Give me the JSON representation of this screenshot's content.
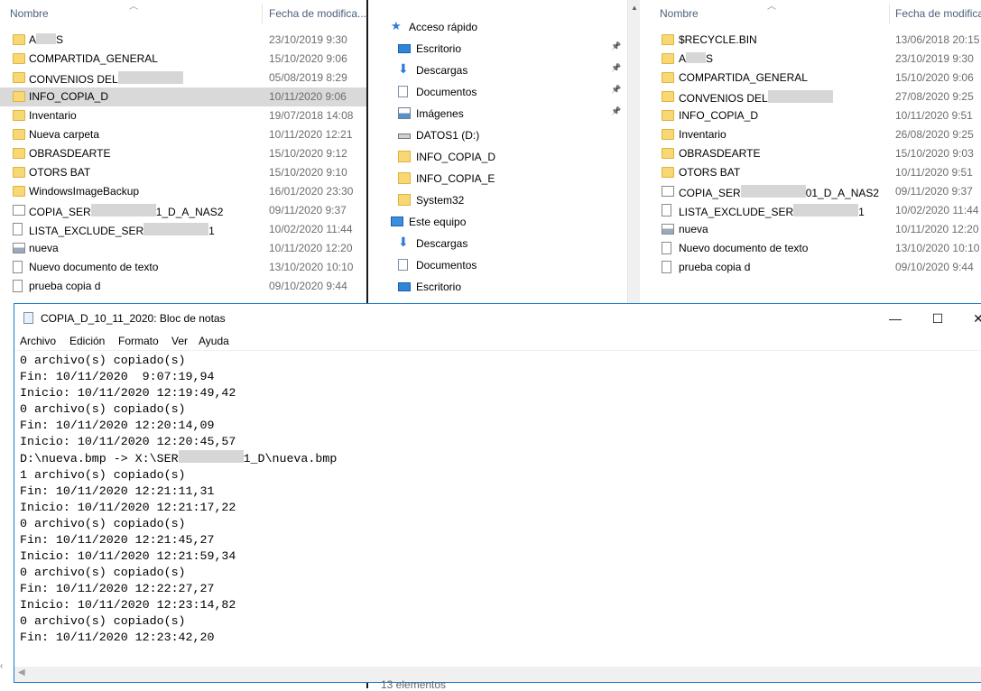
{
  "left_pane": {
    "col_name": "Nombre",
    "col_date": "Fecha de modifica...",
    "rows": [
      {
        "name": "A",
        "name_tail": "S",
        "date": "23/10/2019 9:30",
        "icon": "folder-icon"
      },
      {
        "name": "COMPARTIDA_GENERAL",
        "date": "15/10/2020 9:06",
        "icon": "folder-icon"
      },
      {
        "name": "CONVENIOS DEL",
        "date": "05/08/2019 8:29",
        "icon": "folder-icon"
      },
      {
        "name": "INFO_COPIA_D",
        "date": "10/11/2020 9:06",
        "icon": "folder-icon",
        "selected": true
      },
      {
        "name": "Inventario",
        "date": "19/07/2018 14:08",
        "icon": "folder-icon"
      },
      {
        "name": "Nueva carpeta",
        "date": "10/11/2020 12:21",
        "icon": "folder-icon"
      },
      {
        "name": "OBRASDEARTE",
        "date": "15/10/2020 9:12",
        "icon": "folder-icon"
      },
      {
        "name": "OTORS BAT",
        "date": "15/10/2020 9:10",
        "icon": "folder-icon"
      },
      {
        "name": "WindowsImageBackup",
        "date": "16/01/2020 23:30",
        "icon": "folder-icon"
      },
      {
        "name": "COPIA_SER",
        "name_tail": "1_D_A_NAS2",
        "date": "09/11/2020 9:37",
        "icon": "batch-file-icon"
      },
      {
        "name": "LISTA_EXCLUDE_SER",
        "name_tail": "1",
        "date": "10/02/2020 11:44",
        "icon": "text-file-icon"
      },
      {
        "name": "nueva",
        "date": "10/11/2020 12:20",
        "icon": "bitmap-file-icon"
      },
      {
        "name": "Nuevo documento de texto",
        "date": "13/10/2020 10:10",
        "icon": "text-file-icon"
      },
      {
        "name": "prueba copia d",
        "date": "09/10/2020 9:44",
        "icon": "text-file-icon"
      }
    ]
  },
  "nav_pane": {
    "items": [
      {
        "label": "Acceso rápido",
        "icon": "star-icon",
        "level": 0
      },
      {
        "label": "Escritorio",
        "icon": "desktop-icon",
        "level": 1,
        "pinned": true
      },
      {
        "label": "Descargas",
        "icon": "download-icon",
        "level": 1,
        "pinned": true
      },
      {
        "label": "Documentos",
        "icon": "documents-icon",
        "level": 1,
        "pinned": true
      },
      {
        "label": "Imágenes",
        "icon": "pictures-icon",
        "level": 1,
        "pinned": true
      },
      {
        "label": "DATOS1 (D:)",
        "icon": "drive-icon",
        "level": 1
      },
      {
        "label": "INFO_COPIA_D",
        "icon": "folder-icon",
        "level": 1
      },
      {
        "label": "INFO_COPIA_E",
        "icon": "folder-icon",
        "level": 1
      },
      {
        "label": "System32",
        "icon": "folder-icon",
        "level": 1
      },
      {
        "label": "Este equipo",
        "icon": "computer-icon",
        "level": 0
      },
      {
        "label": "Descargas",
        "icon": "download-icon",
        "level": 1
      },
      {
        "label": "Documentos",
        "icon": "documents-icon",
        "level": 1
      },
      {
        "label": "Escritorio",
        "icon": "desktop-icon",
        "level": 1
      }
    ]
  },
  "right_pane": {
    "col_name": "Nombre",
    "col_date": "Fecha de modifica",
    "rows": [
      {
        "name": "$RECYCLE.BIN",
        "date": "13/06/2018 20:15",
        "icon": "folder-icon"
      },
      {
        "name": "A",
        "name_tail": "S",
        "date": "23/10/2019 9:30",
        "icon": "folder-icon"
      },
      {
        "name": "COMPARTIDA_GENERAL",
        "date": "15/10/2020 9:06",
        "icon": "folder-icon"
      },
      {
        "name": "CONVENIOS DEL",
        "date": "27/08/2020 9:25",
        "icon": "folder-icon"
      },
      {
        "name": "INFO_COPIA_D",
        "date": "10/11/2020 9:51",
        "icon": "folder-icon"
      },
      {
        "name": "Inventario",
        "date": "26/08/2020 9:25",
        "icon": "folder-icon"
      },
      {
        "name": "OBRASDEARTE",
        "date": "15/10/2020 9:03",
        "icon": "folder-icon"
      },
      {
        "name": "OTORS BAT",
        "date": "10/11/2020 9:51",
        "icon": "folder-icon"
      },
      {
        "name": "COPIA_SER",
        "name_tail": "01_D_A_NAS2",
        "date": "09/11/2020 9:37",
        "icon": "batch-file-icon"
      },
      {
        "name": "LISTA_EXCLUDE_SER",
        "name_tail": "1",
        "date": "10/02/2020 11:44",
        "icon": "text-file-icon"
      },
      {
        "name": "nueva",
        "date": "10/11/2020 12:20",
        "icon": "bitmap-file-icon"
      },
      {
        "name": "Nuevo documento de texto",
        "date": "13/10/2020 10:10",
        "icon": "text-file-icon"
      },
      {
        "name": "prueba copia d",
        "date": "09/10/2020 9:44",
        "icon": "text-file-icon"
      }
    ]
  },
  "status_bar": {
    "items_count": "13 elementos"
  },
  "notepad": {
    "title": "COPIA_D_10_11_2020: Bloc de notas",
    "window_buttons": {
      "minimize": "—",
      "maximize": "☐",
      "close": "✕"
    },
    "menu": [
      "Archivo",
      "Edición",
      "Formato",
      "Ver",
      "Ayuda"
    ],
    "lines": [
      "0 archivo(s) copiado(s)",
      "Fin: 10/11/2020  9:07:19,94",
      "Inicio: 10/11/2020 12:19:49,42",
      "0 archivo(s) copiado(s)",
      "Fin: 10/11/2020 12:20:14,09",
      "Inicio: 10/11/2020 12:20:45,57",
      {
        "pre": "D:\\nueva.bmp -> X:\\SER",
        "post": "1_D\\nueva.bmp"
      },
      "1 archivo(s) copiado(s)",
      "Fin: 10/11/2020 12:21:11,31",
      "Inicio: 10/11/2020 12:21:17,22",
      "0 archivo(s) copiado(s)",
      "Fin: 10/11/2020 12:21:45,27",
      "Inicio: 10/11/2020 12:21:59,34",
      "0 archivo(s) copiado(s)",
      "Fin: 10/11/2020 12:22:27,27",
      "Inicio: 10/11/2020 12:23:14,82",
      "0 archivo(s) copiado(s)",
      "Fin: 10/11/2020 12:23:42,20"
    ]
  }
}
